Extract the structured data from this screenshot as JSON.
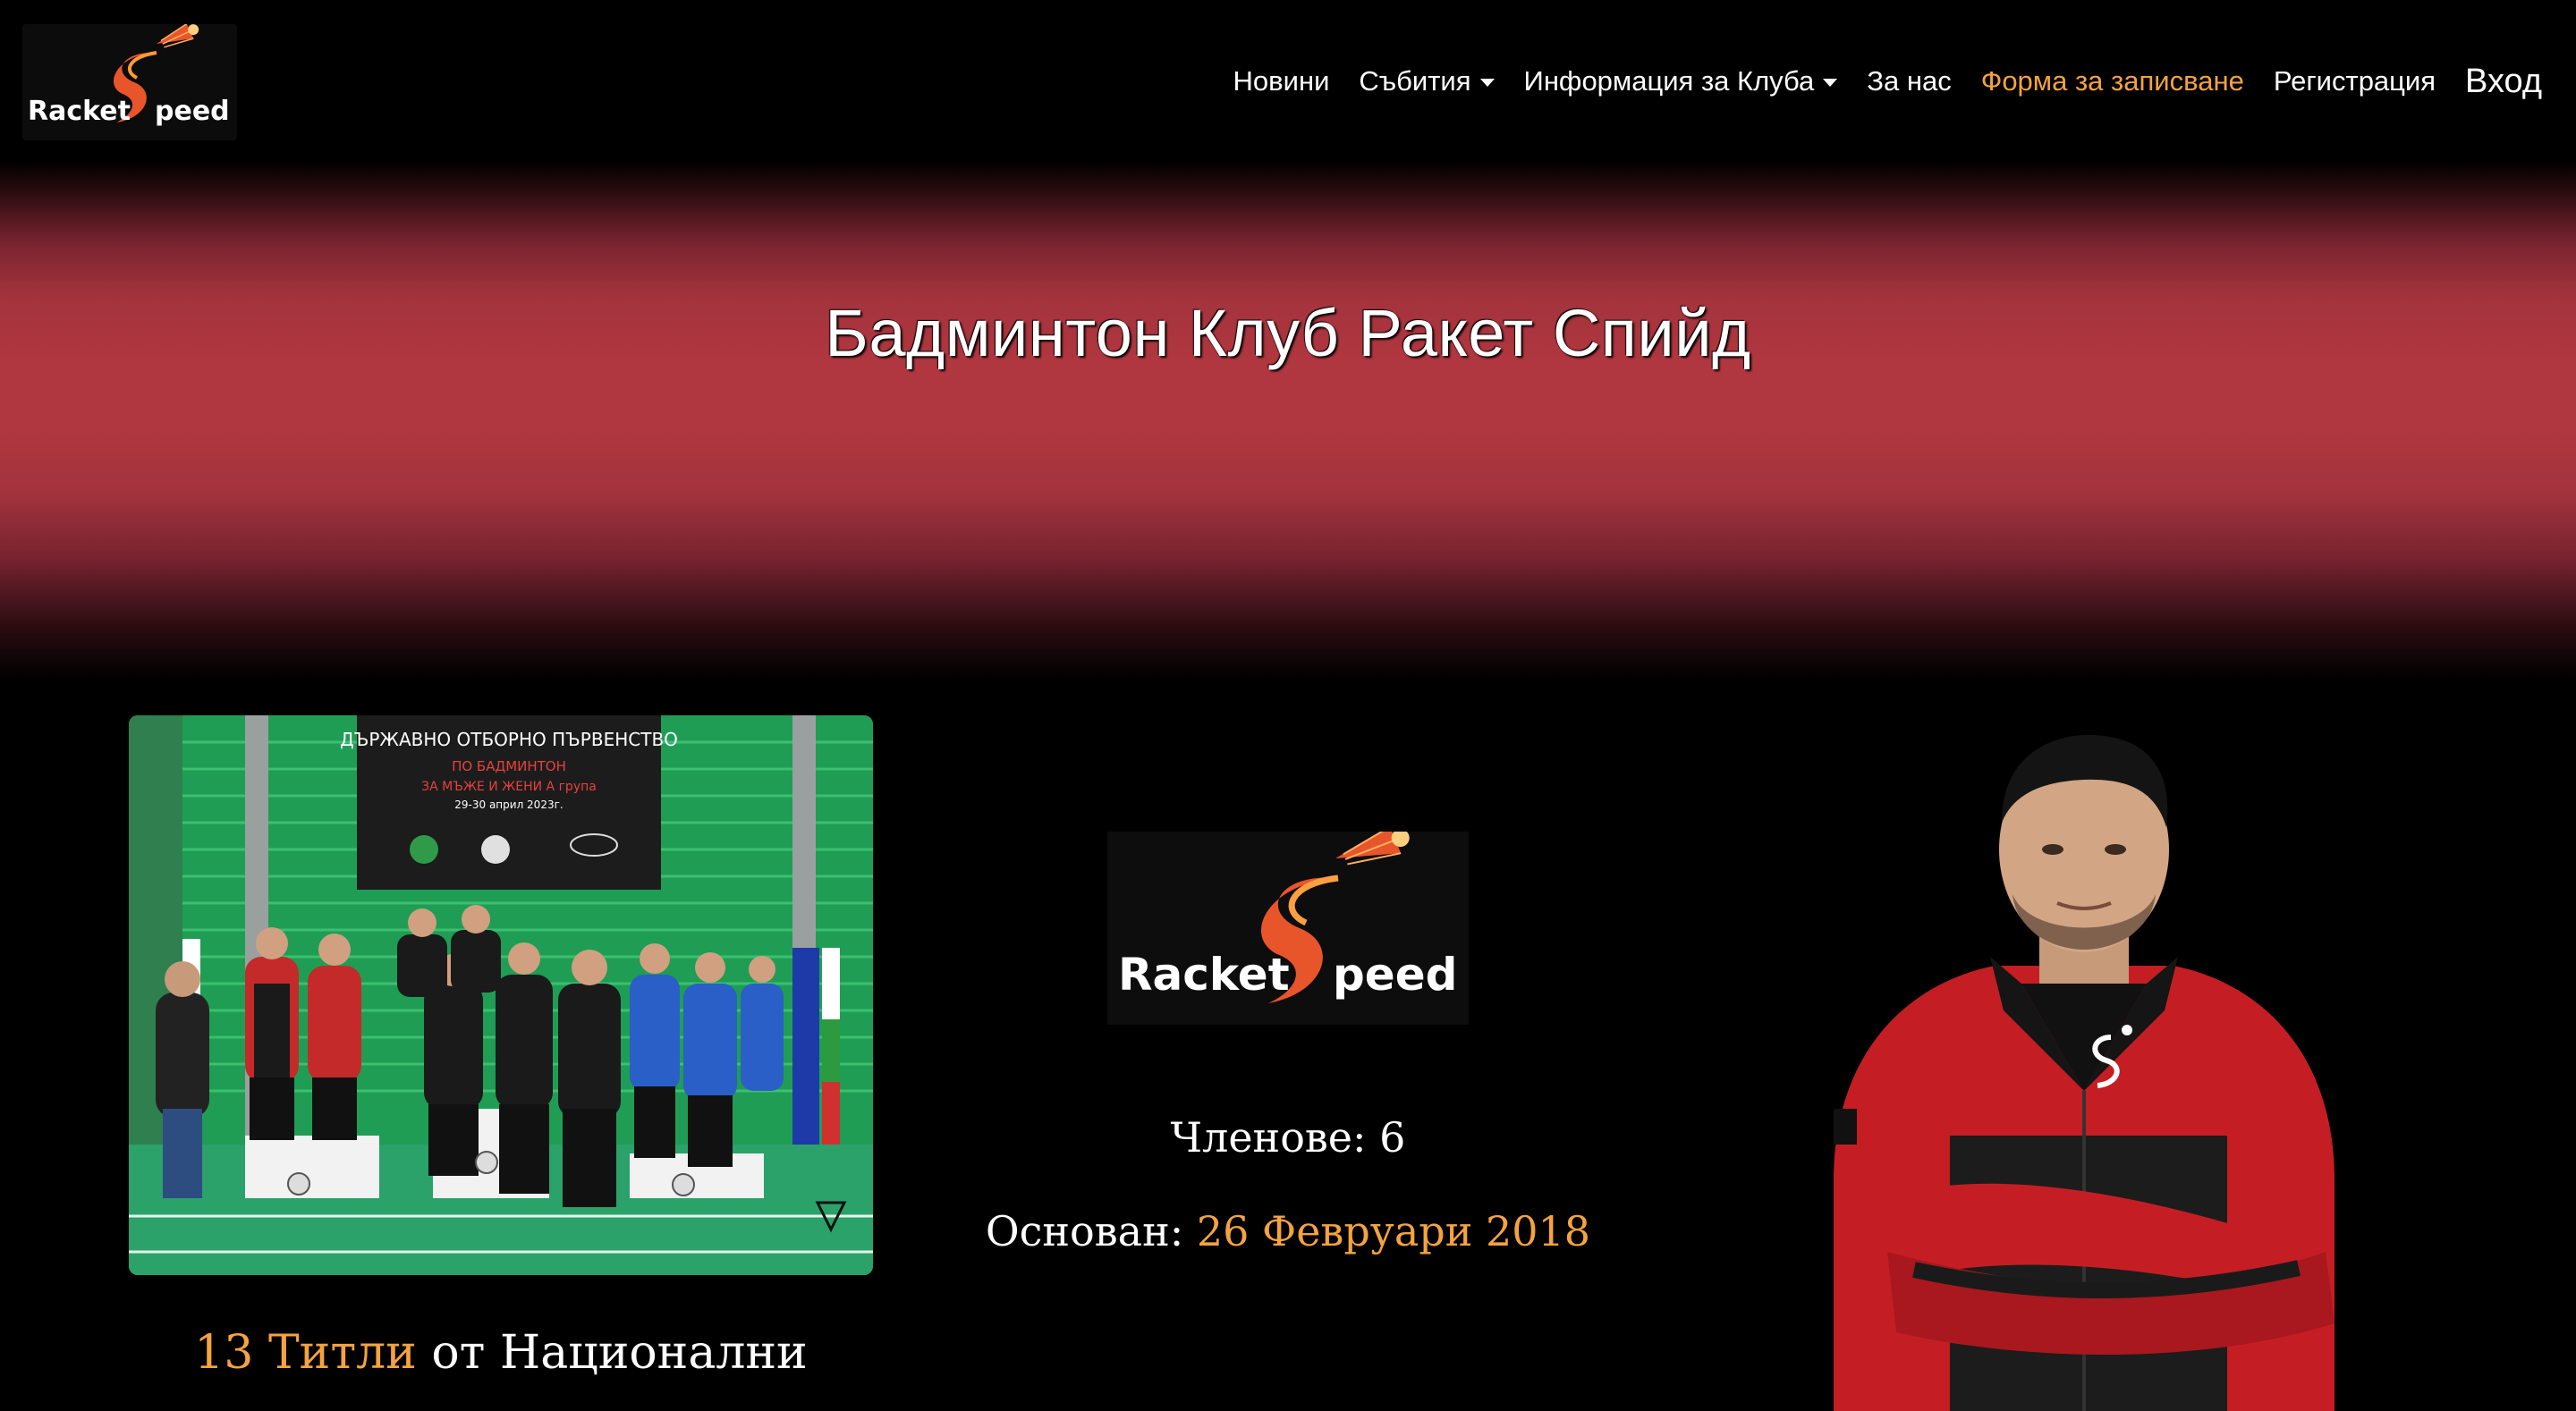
{
  "navbar": {
    "brand": {
      "logo_text_left": "Racket",
      "logo_text_right": "peed"
    },
    "items": [
      {
        "label": "Новини",
        "dropdown": false
      },
      {
        "label": "Събития",
        "dropdown": true
      },
      {
        "label": "Информация за Клуба",
        "dropdown": true
      },
      {
        "label": "За нас",
        "dropdown": false
      },
      {
        "label": "Форма за записване",
        "dropdown": false,
        "active": true
      },
      {
        "label": "Регистрация",
        "dropdown": false
      },
      {
        "label": "Вход",
        "dropdown": false
      }
    ]
  },
  "hero": {
    "title": "Бадминтон Клуб Ракет Спийд"
  },
  "photo_banner": {
    "line1": "ДЪРЖАВНО ОТБОРНО ПЪРВЕНСТВО",
    "line2": "ПО БАДМИНТОН",
    "line3": "ЗА МЪЖЕ И ЖЕНИ    А група",
    "line4": "29-30 април 2023г."
  },
  "club_logo": {
    "text_left": "Racket",
    "text_right": "peed"
  },
  "stats": {
    "members_label": "Членове:",
    "members_value": "6",
    "founded_label": "Основан:",
    "founded_value": "26 Февруари 2018",
    "titles_count": "13 Титли",
    "titles_suffix": "от Национални"
  },
  "colors": {
    "accent": "#f4a340",
    "hero_red": "#b0363f",
    "background": "#000000"
  }
}
